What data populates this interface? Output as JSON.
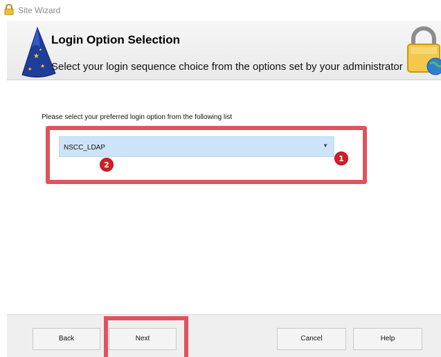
{
  "window": {
    "title": "Site Wizard"
  },
  "header": {
    "heading": "Login Option Selection",
    "subheading": "Select your login sequence choice from the options set by your administrator",
    "wizard_icon": "wizard-hat-icon",
    "lock_icon": "padlock-globe-icon"
  },
  "main": {
    "prompt": "Please select your preferred  login option from the following list",
    "login_option": {
      "selected": "NSCC_LDAP"
    }
  },
  "annotations": {
    "badge_1": "1",
    "badge_2": "2",
    "callout_color": "#e0535c",
    "badge_color": "#d21f26"
  },
  "buttons": {
    "back": "Back",
    "next": "Next",
    "cancel": "Cancel",
    "help": "Help"
  }
}
